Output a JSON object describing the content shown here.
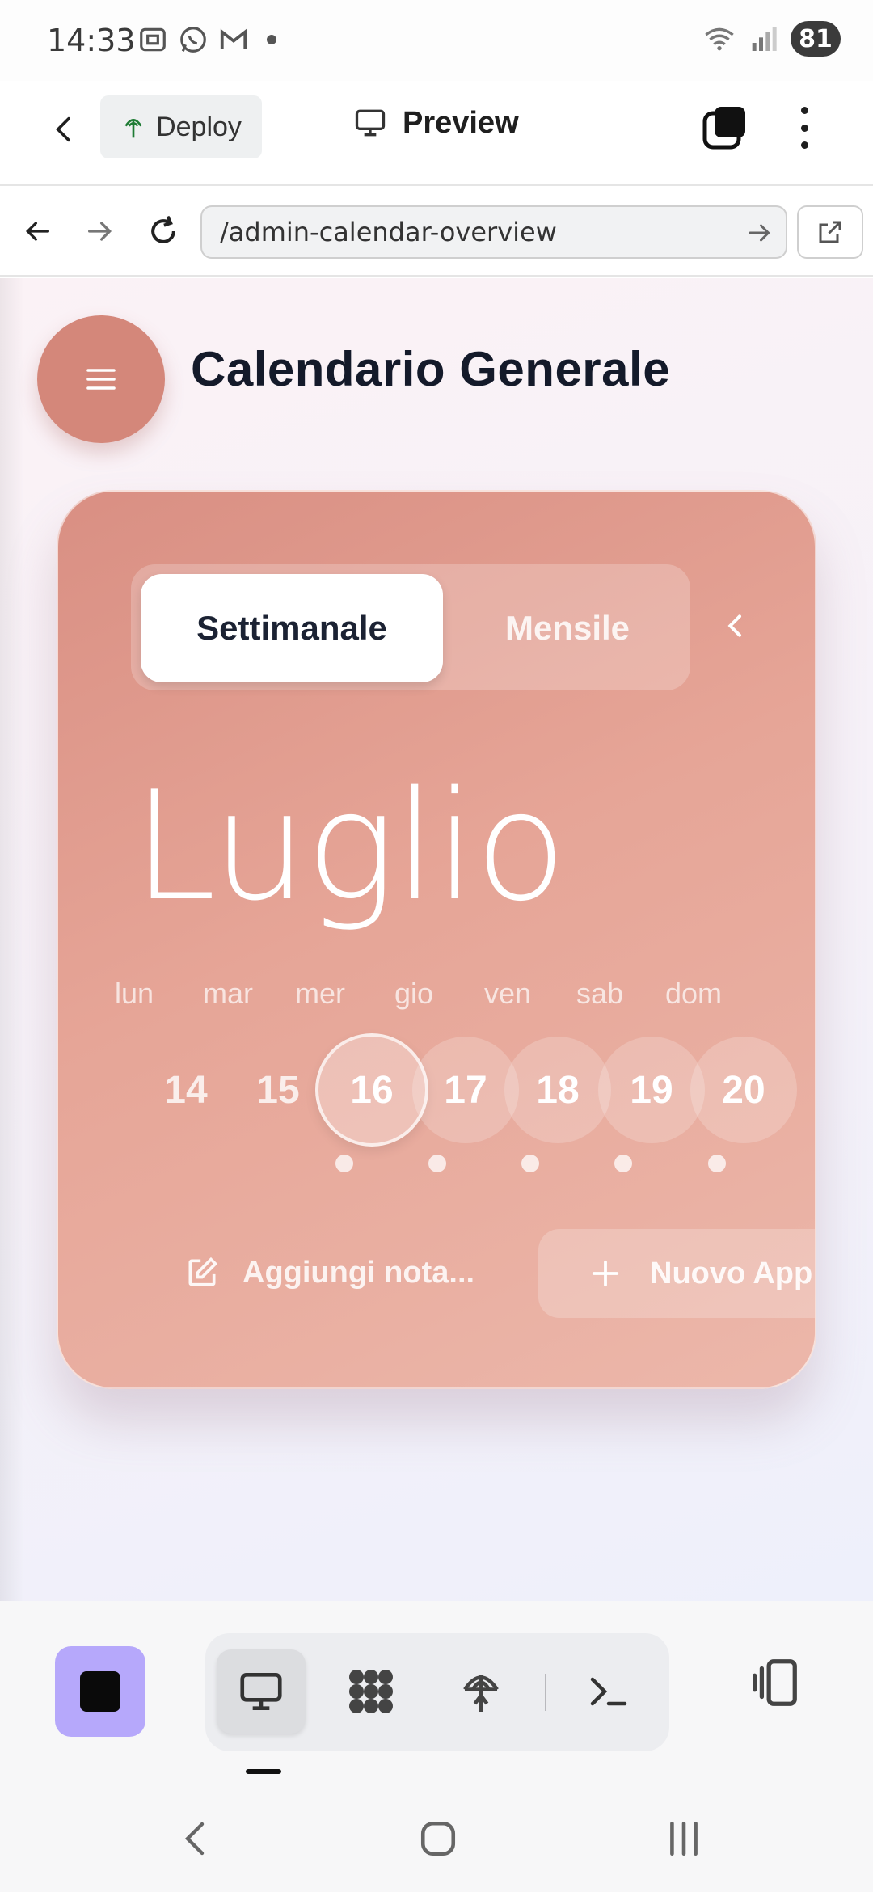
{
  "status_bar": {
    "time": "14:33",
    "battery": "81",
    "left_icons": [
      "screenshot-icon",
      "whatsapp-icon",
      "gmail-icon",
      "dot-icon"
    ],
    "right_icons": [
      "wifi-icon",
      "signal-icon",
      "battery-icon"
    ]
  },
  "toolbar": {
    "deploy_label": "Deploy",
    "preview_label": "Preview",
    "icons": [
      "back-icon",
      "deploy-icon",
      "monitor-icon",
      "tabs-icon",
      "more-vert-icon"
    ]
  },
  "browser": {
    "url": "/admin-calendar-overview",
    "icons": [
      "arrow-back-icon",
      "arrow-forward-icon",
      "reload-icon",
      "go-icon",
      "open-external-icon"
    ]
  },
  "page": {
    "title": "Calendario Generale",
    "menu_icon": "hamburger-icon",
    "accent_color": "#d4877a"
  },
  "calendar": {
    "view_toggle": {
      "week_label": "Settimanale",
      "month_label": "Mensile",
      "selected": "Settimanale"
    },
    "month": "Luglio",
    "weekdays": [
      "lun",
      "mar",
      "mer",
      "gio",
      "ven",
      "sab",
      "dom"
    ],
    "days": [
      "14",
      "15",
      "16",
      "17",
      "18",
      "19",
      "20"
    ],
    "today": "16",
    "days_with_events": [
      "16",
      "17",
      "18",
      "19",
      "20"
    ],
    "add_note_label": "Aggiungi nota...",
    "new_appointment_label": "Nuovo App"
  },
  "bottom_bar": {
    "stop_color": "#b6a8fb",
    "tools": [
      "desktop-icon",
      "apps-icon",
      "deploy-icon",
      "terminal-icon"
    ],
    "active_tool": "desktop-icon",
    "device_icon": "device-toggle-icon"
  },
  "system_nav": [
    "nav-back-icon",
    "nav-home-icon",
    "nav-recents-icon"
  ]
}
